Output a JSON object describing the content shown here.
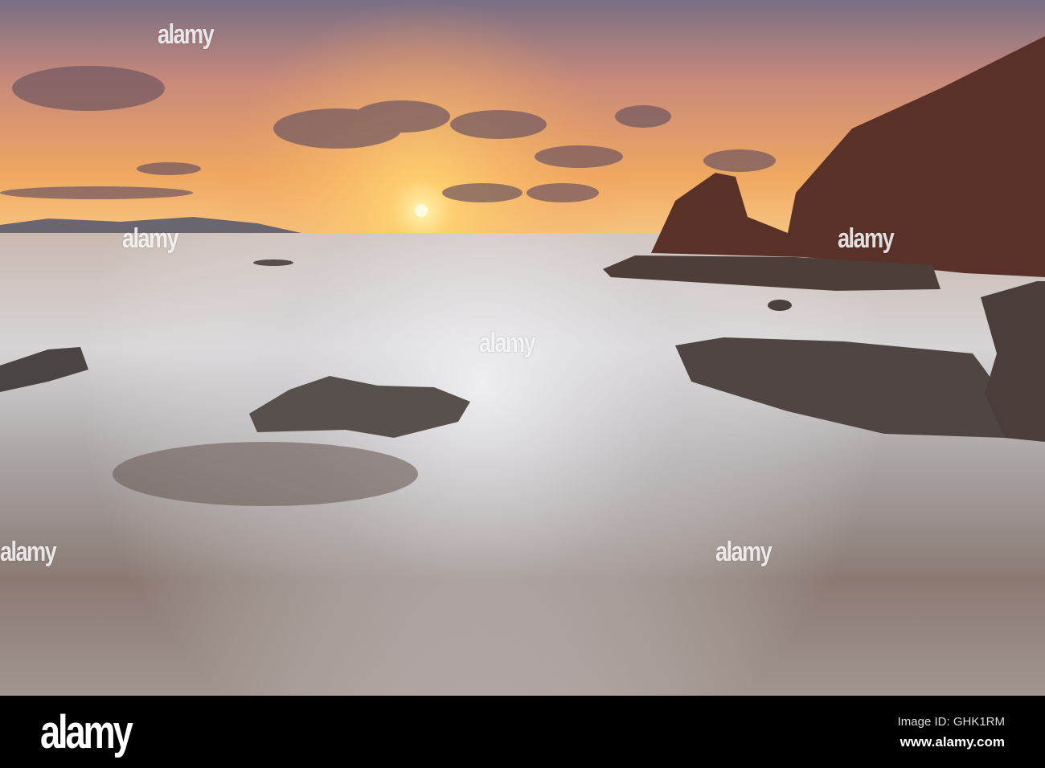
{
  "watermark": "alamy",
  "footer": {
    "logo": "alamy",
    "image_id": "Image ID: GHK1RM",
    "url": "www.alamy.com"
  }
}
